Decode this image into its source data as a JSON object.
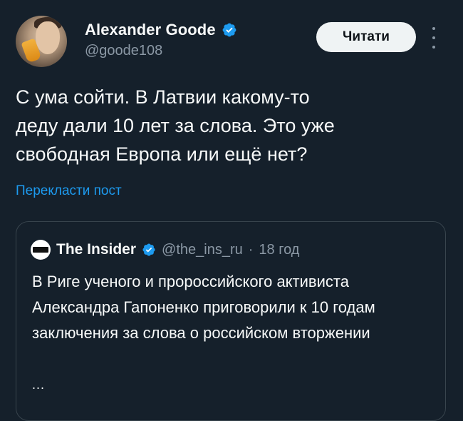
{
  "author": {
    "display_name": "Alexander Goode",
    "handle": "@goode108",
    "verified": true
  },
  "actions": {
    "follow_label": "Читати",
    "more_icon": "more-vertical-icon"
  },
  "tweet": {
    "text": "С ума сойти. В Латвии какому-то\nдеду дали 10 лет за слова. Это уже\nсвободная Европа или ещё нет?",
    "translate_label": "Перекласти пост"
  },
  "quoted_tweet": {
    "display_name": "The Insider",
    "handle": "@the_ins_ru",
    "separator": "·",
    "time": "18 год",
    "verified": true,
    "text": "В Риге ученого и пророссийского активиста Александра Гапоненко приговорили к 10 годам заключения за слова о российском вторжении",
    "ellipsis": "..."
  },
  "colors": {
    "background": "#15202b",
    "text_primary": "#f7f9f9",
    "text_secondary": "#8b98a5",
    "link": "#1d9bf0",
    "verified_badge": "#1d9bf0",
    "border": "#38444d",
    "button_bg": "#eff3f4"
  }
}
